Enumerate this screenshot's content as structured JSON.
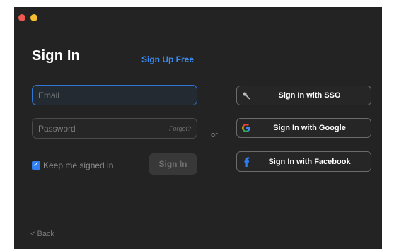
{
  "title": "Sign In",
  "signup_link": "Sign Up Free",
  "email": {
    "placeholder": "Email",
    "value": ""
  },
  "password": {
    "placeholder": "Password",
    "value": "",
    "forgot": "Forgot?"
  },
  "keep_signed_in": {
    "label": "Keep me signed in",
    "checked": true
  },
  "signin_button": "Sign In",
  "or_label": "or",
  "sso_buttons": [
    {
      "label": "Sign In with SSO",
      "icon": "key-icon"
    },
    {
      "label": "Sign In with Google",
      "icon": "google-icon"
    },
    {
      "label": "Sign In with Facebook",
      "icon": "facebook-icon"
    }
  ],
  "back_link": "< Back",
  "colors": {
    "window_bg": "#232323",
    "accent": "#2f7ff3",
    "link": "#3a8df2",
    "close_dot": "#ed5a51",
    "minimize_dot": "#f4bf2e"
  }
}
